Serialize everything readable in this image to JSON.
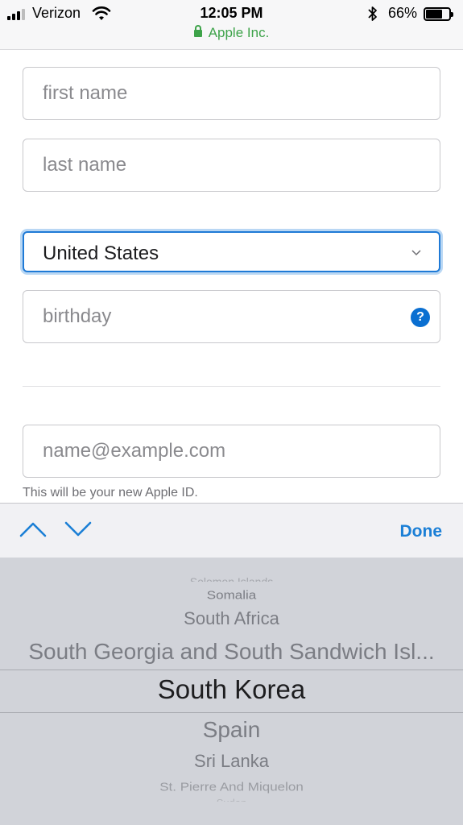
{
  "status_bar": {
    "carrier": "Verizon",
    "time": "12:05 PM",
    "battery_percent": "66%",
    "battery_level": 0.66,
    "url": "Apple Inc."
  },
  "form": {
    "first_name_placeholder": "first name",
    "last_name_placeholder": "last name",
    "country_value": "United States",
    "birthday_placeholder": "birthday",
    "help_icon": "?",
    "email_placeholder": "name@example.com",
    "email_hint": "This will be your new Apple ID."
  },
  "accessory": {
    "done_label": "Done"
  },
  "picker": {
    "items_above": [
      "Solomon Islands",
      "Somalia",
      "South Africa",
      "South Georgia and South Sandwich Isl..."
    ],
    "selected": "South Korea",
    "items_below": [
      "Spain",
      "Sri Lanka",
      "St. Pierre And Miquelon",
      "Sudan"
    ]
  },
  "colors": {
    "accent": "#1b7fd6",
    "secure_green": "#3ea34a",
    "help_blue": "#0a6fd1",
    "picker_bg": "#d1d3d9"
  },
  "icons": [
    "signal-icon",
    "wifi-icon",
    "bluetooth-icon",
    "battery-icon",
    "lock-icon",
    "chevron-down-icon",
    "help-icon",
    "chevron-up-icon"
  ]
}
